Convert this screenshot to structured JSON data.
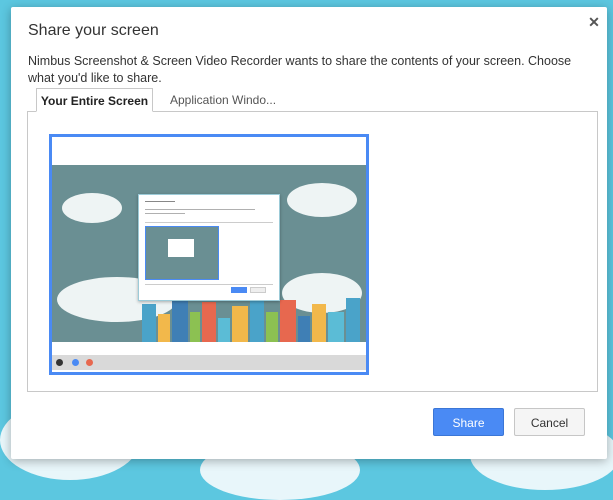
{
  "dialog": {
    "title": "Share your screen",
    "close_icon": "close-icon",
    "description": "Nimbus Screenshot & Screen Video Recorder wants to share the contents of your screen. Choose what you'd like to share."
  },
  "tabs": [
    {
      "label": "Your Entire Screen",
      "active": true
    },
    {
      "label": "Application Windo...",
      "active": false
    }
  ],
  "preview": {
    "name": "entire-screen-thumbnail",
    "selected": true
  },
  "buttons": {
    "share_label": "Share",
    "cancel_label": "Cancel"
  },
  "colors": {
    "accent": "#4a8af4",
    "background": "#5cc7e0"
  }
}
